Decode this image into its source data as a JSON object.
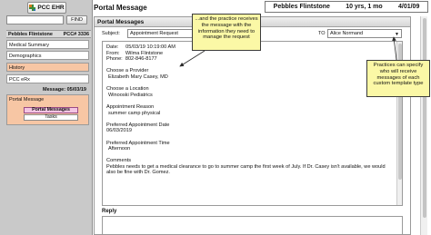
{
  "sidebar": {
    "app_button": "PCC EHR",
    "find_button": "FIND",
    "find_placeholder": "",
    "patient_name": "Pebbles Flintstone",
    "patient_id": "PCC# 3336",
    "nav_items": [
      {
        "label": "Medical Summary"
      },
      {
        "label": "Demographics"
      },
      {
        "label": "History"
      },
      {
        "label": "PCC eRx"
      }
    ],
    "section_label": "Message: 05/03/19",
    "section_item": "Portal Message",
    "sub_tabs": [
      {
        "label": "Portal Messages"
      },
      {
        "label": "Tasks"
      }
    ]
  },
  "header": {
    "title": "Portal Message",
    "patient_name": "Pebbles Flintstone",
    "age": "10 yrs, 1 mo",
    "dob": "4/01/09"
  },
  "panel": {
    "title": "Portal Messages",
    "subject_label": "Subject:",
    "subject_value": "Appointment Request",
    "to_label": "TO",
    "to_value": "Alice Normand",
    "reply_label": "Reply",
    "message": {
      "date_line": "Date:     05/03/19 10:19:00 AM",
      "from_line": "From:    Wilma Flintstone",
      "phone_line": "Phone:  802-846-8177",
      "provider_heading": "Choose a Provider",
      "provider_value": "Elizabeth Mary Casey, MD",
      "location_heading": "Choose a Location",
      "location_value": "Winooski Pediatrics",
      "reason_heading": "Appointment Reason",
      "reason_value": "summer camp physical",
      "pref_date_heading": "Preferred Appointment Date",
      "pref_date_value": "06/03/2019",
      "pref_time_heading": "Preferred Appointment Time",
      "pref_time_value": "Afternoon",
      "comments_heading": "Comments",
      "comments_value": "Pebbles needs to get a medical clearance to go to summer camp the first week of July. If Dr. Casey isn't available, we would also be fine with Dr. Gomez."
    }
  },
  "callouts": {
    "practice_receives": "...and the practice receives the message with the information they need to manage the request",
    "practice_specify": "Practices can specify who will receive messages of each custom template type"
  },
  "colors": {
    "active_nav": "#f7c6a4",
    "active_subtab": "#f3c4e2",
    "callout_bg": "#fbf8a6"
  }
}
